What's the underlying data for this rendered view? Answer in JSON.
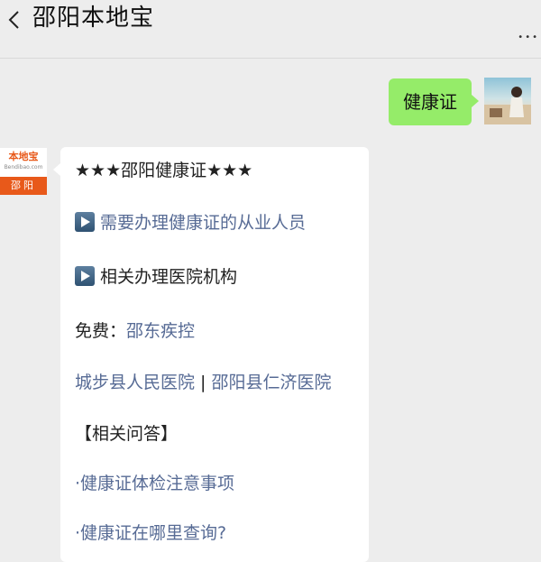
{
  "header": {
    "title": "邵阳本地宝",
    "more": "•••"
  },
  "outgoing": {
    "text": "健康证"
  },
  "bot": {
    "avatar_brand": "本地宝",
    "avatar_domain": "Bendibao.com",
    "avatar_city": "邵阳"
  },
  "message": {
    "heading": "★★★邵阳健康证★★★",
    "item1": "需要办理健康证的从业人员",
    "item2": "相关办理医院机构",
    "free_label": "免费：",
    "free_link": "邵东疾控",
    "hospital1": "城步县人民医院",
    "separator": " | ",
    "hospital2": "邵阳县仁济医院",
    "qa_title": "【相关问答】",
    "qa1": "·健康证体检注意事项",
    "qa2": "·健康证在哪里查询?"
  },
  "colors": {
    "link": "#576b95",
    "outgoing_bubble": "#95ec69",
    "brand": "#e8591a"
  }
}
